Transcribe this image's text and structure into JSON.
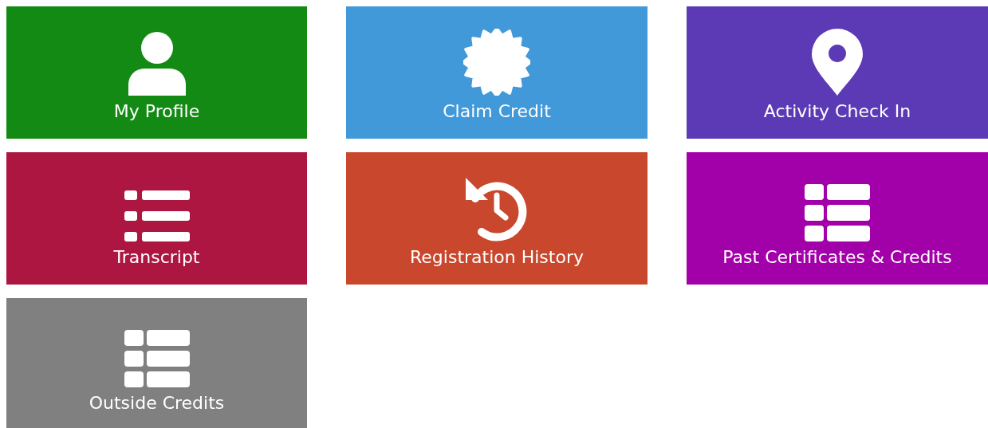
{
  "tiles": [
    {
      "label": "My Profile",
      "kind": "profile",
      "color": "#138a13"
    },
    {
      "label": "Claim Credit",
      "kind": "badge",
      "color": "#4299d9"
    },
    {
      "label": "Activity Check In",
      "kind": "pin",
      "color": "#5c3ab5"
    },
    {
      "label": "Transcript",
      "kind": "list",
      "color": "#ad1641"
    },
    {
      "label": "Registration History",
      "kind": "history",
      "color": "#c9472c"
    },
    {
      "label": "Past Certificates & Credits",
      "kind": "table",
      "color": "#a200a8"
    },
    {
      "label": "Outside Credits",
      "kind": "table",
      "color": "#808080"
    }
  ]
}
